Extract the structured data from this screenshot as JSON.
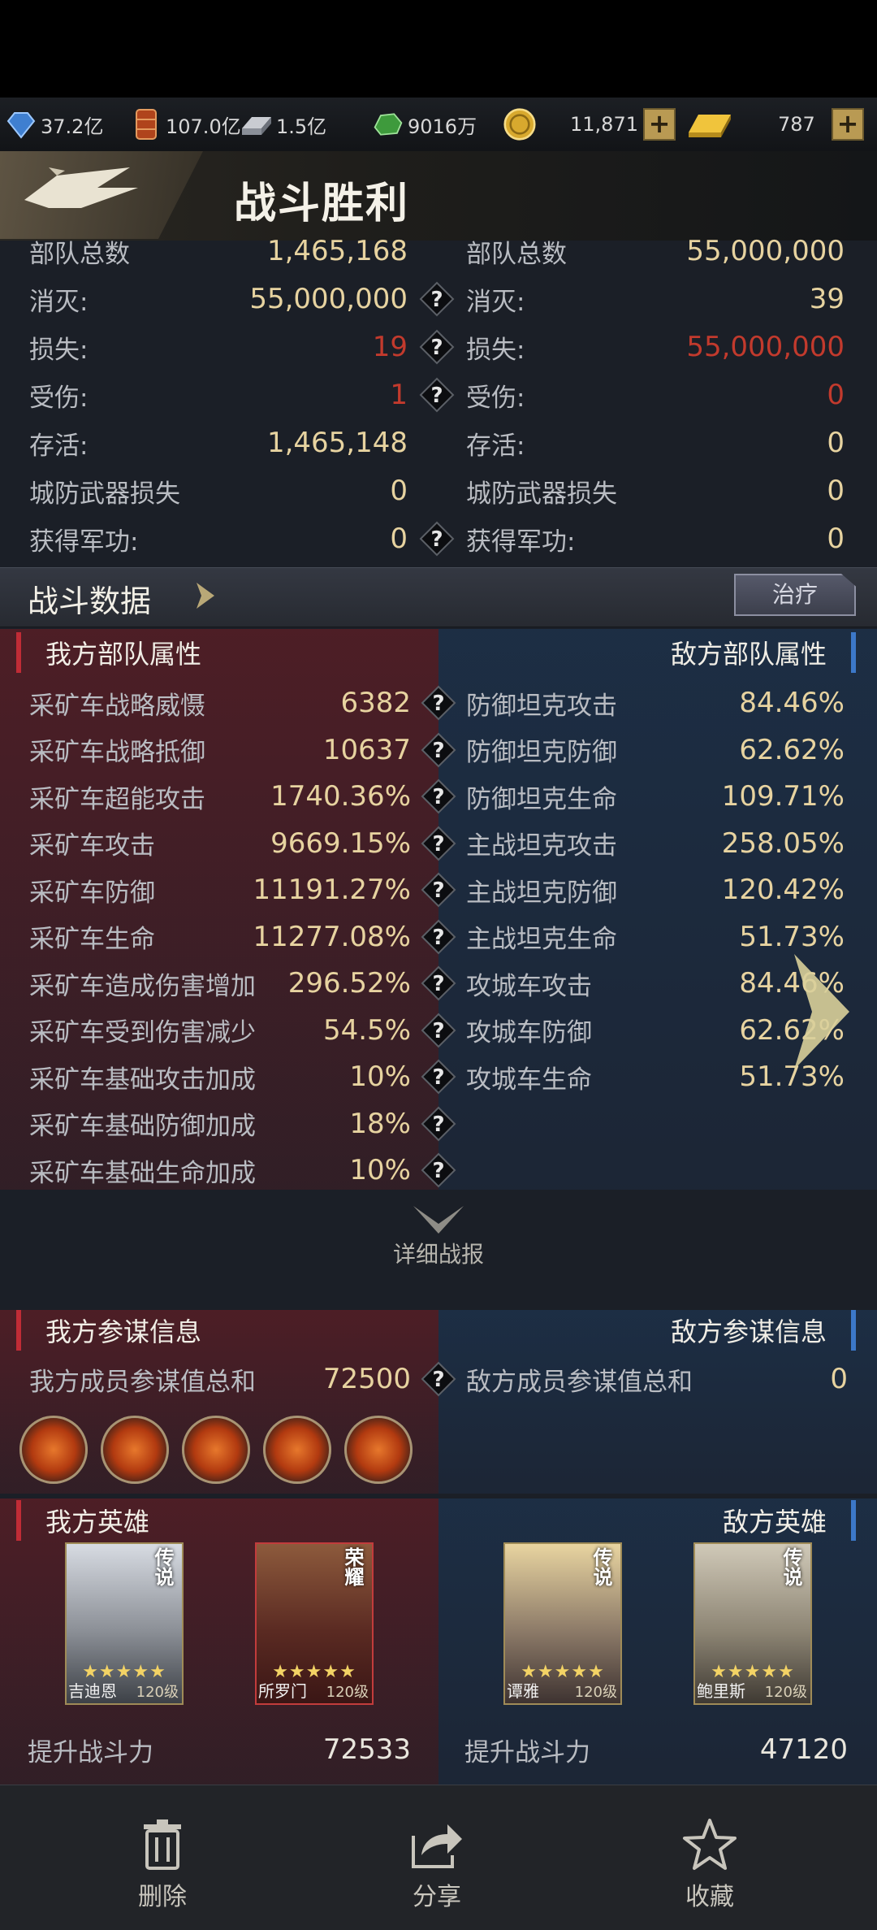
{
  "resources": [
    {
      "icon": "crystal-icon",
      "value": "37.2亿"
    },
    {
      "icon": "oil-barrel-icon",
      "value": "107.0亿"
    },
    {
      "icon": "steel-icon",
      "value": "1.5亿"
    },
    {
      "icon": "ore-icon",
      "value": "9016万"
    },
    {
      "icon": "gold-coin-icon",
      "value": "11,871"
    },
    {
      "icon": "gold-bar-icon",
      "value": "787"
    }
  ],
  "header": {
    "title": "战斗胜利"
  },
  "summary": {
    "rows": [
      {
        "l_label": "部队总数",
        "l_value": "1,465,168",
        "l_q": false,
        "r_label": "部队总数",
        "r_value": "55,000,000",
        "r_red": false,
        "l_red": false
      },
      {
        "l_label": "消灭:",
        "l_value": "55,000,000",
        "l_q": true,
        "r_label": "消灭:",
        "r_value": "39",
        "r_red": false,
        "l_red": false
      },
      {
        "l_label": "损失:",
        "l_value": "19",
        "l_q": true,
        "r_label": "损失:",
        "r_value": "55,000,000",
        "r_red": true,
        "l_red": true
      },
      {
        "l_label": "受伤:",
        "l_value": "1",
        "l_q": true,
        "r_label": "受伤:",
        "r_value": "0",
        "r_red": true,
        "l_red": true
      },
      {
        "l_label": "存活:",
        "l_value": "1,465,148",
        "l_q": false,
        "r_label": "存活:",
        "r_value": "0",
        "r_red": false,
        "l_red": false
      },
      {
        "l_label": "城防武器损失",
        "l_value": "0",
        "l_q": false,
        "r_label": "城防武器损失",
        "r_value": "0",
        "r_red": false,
        "l_red": false
      },
      {
        "l_label": "获得军功:",
        "l_value": "0",
        "l_q": true,
        "r_label": "获得军功:",
        "r_value": "0",
        "r_red": false,
        "l_red": false
      }
    ]
  },
  "battle_data": {
    "title": "战斗数据",
    "heal_button": "治疗"
  },
  "attributes": {
    "left_title": "我方部队属性",
    "right_title": "敌方部队属性",
    "left": [
      {
        "label": "采矿车战略威慑",
        "value": "6382"
      },
      {
        "label": "采矿车战略抵御",
        "value": "10637"
      },
      {
        "label": "采矿车超能攻击",
        "value": "1740.36%"
      },
      {
        "label": "采矿车攻击",
        "value": "9669.15%"
      },
      {
        "label": "采矿车防御",
        "value": "11191.27%"
      },
      {
        "label": "采矿车生命",
        "value": "11277.08%"
      },
      {
        "label": "采矿车造成伤害增加",
        "value": "296.52%"
      },
      {
        "label": "采矿车受到伤害减少",
        "value": "54.5%"
      },
      {
        "label": "采矿车基础攻击加成",
        "value": "10%"
      },
      {
        "label": "采矿车基础防御加成",
        "value": "18%"
      },
      {
        "label": "采矿车基础生命加成",
        "value": "10%"
      }
    ],
    "right": [
      {
        "label": "防御坦克攻击",
        "value": "84.46%"
      },
      {
        "label": "防御坦克防御",
        "value": "62.62%"
      },
      {
        "label": "防御坦克生命",
        "value": "109.71%"
      },
      {
        "label": "主战坦克攻击",
        "value": "258.05%"
      },
      {
        "label": "主战坦克防御",
        "value": "120.42%"
      },
      {
        "label": "主战坦克生命",
        "value": "51.73%"
      },
      {
        "label": "攻城车攻击",
        "value": "84.46%"
      },
      {
        "label": "攻城车防御",
        "value": "62.62%"
      },
      {
        "label": "攻城车生命",
        "value": "51.73%"
      }
    ]
  },
  "detail_report": "详细战报",
  "advisors": {
    "left_title": "我方参谋信息",
    "right_title": "敌方参谋信息",
    "left_label": "我方成员参谋值总和",
    "left_value": "72500",
    "right_label": "敌方成员参谋值总和",
    "right_value": "0"
  },
  "heroes": {
    "left_title": "我方英雄",
    "right_title": "敌方英雄",
    "left": [
      {
        "name": "吉迪恩",
        "level": "120级",
        "tag": "传说",
        "stars": "★★★★★"
      },
      {
        "name": "所罗门",
        "level": "120级",
        "tag": "荣耀",
        "stars": "★★★★★"
      }
    ],
    "right": [
      {
        "name": "谭雅",
        "level": "120级",
        "tag": "传说",
        "stars": "★★★★★"
      },
      {
        "name": "鲍里斯",
        "level": "120级",
        "tag": "传说",
        "stars": "★★★★★"
      }
    ],
    "left_power_label": "提升战斗力",
    "left_power": "72533",
    "right_power_label": "提升战斗力",
    "right_power": "47120"
  },
  "toolbar": {
    "delete": "删除",
    "share": "分享",
    "favorite": "收藏"
  },
  "colors": {
    "gold": "#e7d3a0",
    "red": "#c23a2d",
    "panel": "#1b1f27"
  }
}
